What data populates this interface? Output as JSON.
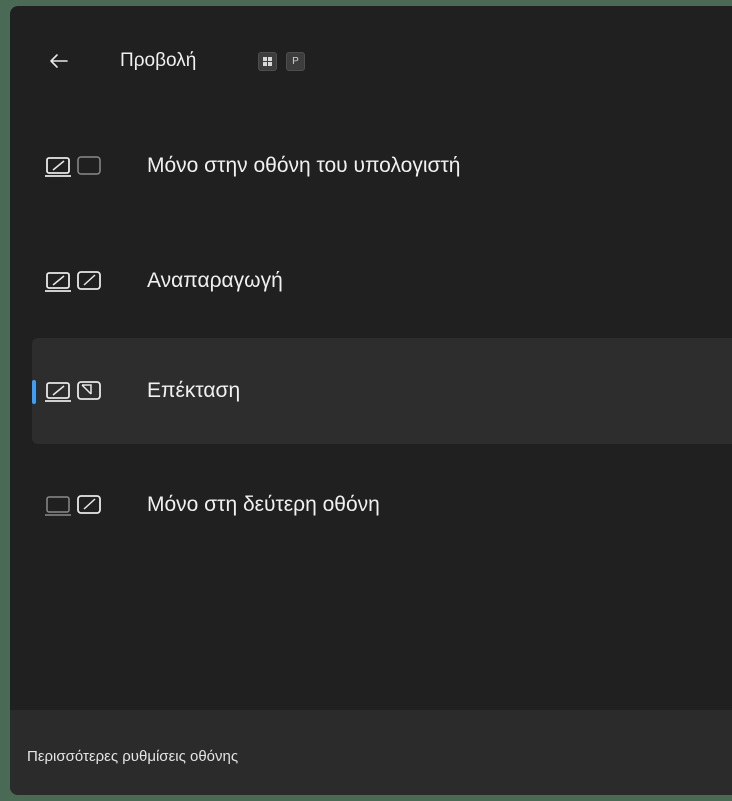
{
  "header": {
    "back_icon": "arrow-left-icon",
    "title": "Προβολή",
    "shortcut_keys": [
      {
        "icon": "windows-key-icon",
        "label": ""
      },
      {
        "icon": "key-p-icon",
        "label": "P"
      }
    ]
  },
  "options": [
    {
      "label": "Μόνο στην οθόνη του υπολογιστή",
      "icon": "pc-screen-only-icon",
      "selected": false
    },
    {
      "label": "Αναπαραγωγή",
      "icon": "duplicate-icon",
      "selected": false
    },
    {
      "label": "Επέκταση",
      "icon": "extend-icon",
      "selected": true
    },
    {
      "label": "Μόνο στη δεύτερη οθόνη",
      "icon": "second-screen-only-icon",
      "selected": false
    }
  ],
  "footer": {
    "link_label": "Περισσότερες ρυθμίσεις οθόνης"
  },
  "colors": {
    "panel_bg": "#202020",
    "selected_bg": "#2d2d2d",
    "accent": "#3c9ef5",
    "footer_bg": "#2b2b2b",
    "text": "#f0f0f0"
  }
}
